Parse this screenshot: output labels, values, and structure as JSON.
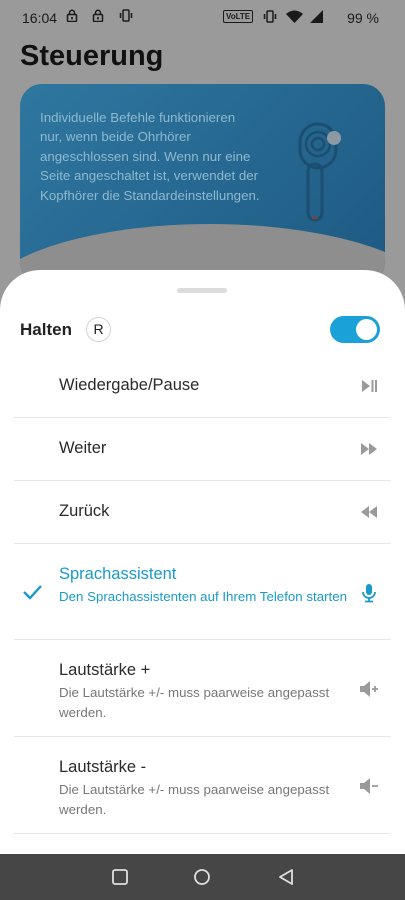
{
  "status_bar": {
    "time": "16:04",
    "network_badge": "VoLTE",
    "battery": "99 %"
  },
  "background": {
    "title": "Steuerung",
    "info_text": "Individuelle Befehle funktionieren nur, wenn beide Ohrhörer angeschlossen sind. Wenn nur eine Seite angeschaltet ist, verwendet der Kopfhörer die Standardeinstellungen."
  },
  "sheet": {
    "title": "Halten",
    "side_badge": "R",
    "toggle_on": true,
    "accent_color": "#1aa2d8",
    "items": [
      {
        "label": "Wiedergabe/Pause",
        "icon": "play-pause-icon",
        "selected": false
      },
      {
        "label": "Weiter",
        "icon": "fast-forward-icon",
        "selected": false
      },
      {
        "label": "Zurück",
        "icon": "rewind-icon",
        "selected": false
      },
      {
        "label": "Sprachassistent",
        "desc": "Den Sprachassistenten auf Ihrem Telefon starten",
        "icon": "microphone-icon",
        "selected": true
      },
      {
        "label": "Lautstärke +",
        "desc": "Die Lautstärke +/- muss paarweise angepasst werden.",
        "icon": "volume-up-icon",
        "selected": false
      },
      {
        "label": "Lautstärke -",
        "desc": "Die Lautstärke +/- muss paarweise angepasst werden.",
        "icon": "volume-down-icon",
        "selected": false
      }
    ]
  },
  "nav_bar": {
    "buttons": [
      "recents",
      "home",
      "back"
    ]
  }
}
